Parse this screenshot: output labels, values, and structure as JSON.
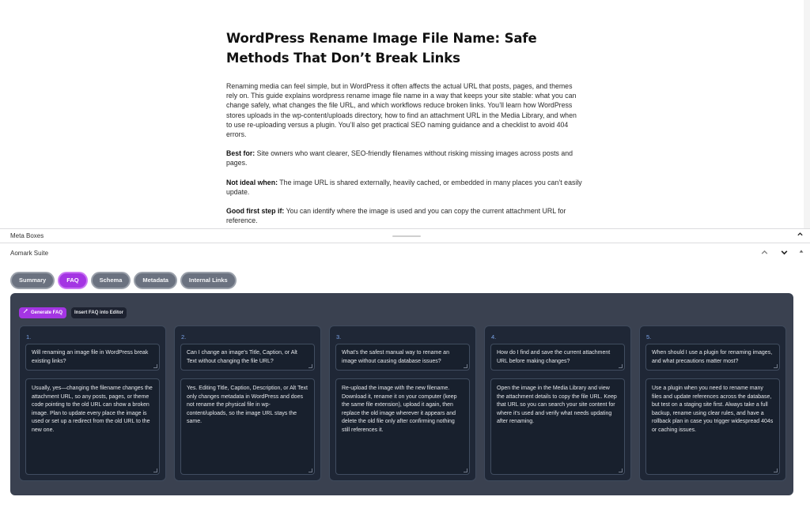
{
  "article": {
    "title": "WordPress Rename Image File Name: Safe Methods That Don’t Break Links",
    "intro": "Renaming media can feel simple, but in WordPress it often affects the actual URL that posts, pages, and themes rely on. This guide explains wordpress rename image file name in a way that keeps your site stable: what you can change safely, what changes the file URL, and which workflows reduce broken links. You’ll learn how WordPress stores uploads in the wp-content/uploads directory, how to find an attachment URL in the Media Library, and when to use re-uploading versus a plugin. You’ll also get practical SEO naming guidance and a checklist to avoid 404 errors.",
    "best_for_label": "Best for:",
    "best_for_text": " Site owners who want clearer, SEO-friendly filenames without risking missing images across posts and pages.",
    "not_ideal_label": "Not ideal when:",
    "not_ideal_text": " The image URL is shared externally, heavily cached, or embedded in many places you can’t easily update.",
    "first_step_label": "Good first step if:",
    "first_step_text": " You can identify where the image is used and you can copy the current attachment URL for reference."
  },
  "metabar": {
    "label": "Meta Boxes",
    "toggle_icon": "chevron-up-icon"
  },
  "suite": {
    "label": "Aomark Suite",
    "controls": {
      "up": "chevron-up-icon",
      "down": "chevron-down-icon",
      "collapse": "triangle-up-icon"
    },
    "tabs": [
      {
        "label": "Summary",
        "active": false
      },
      {
        "label": "FAQ",
        "active": true
      },
      {
        "label": "Schema",
        "active": false
      },
      {
        "label": "Metadata",
        "active": false
      },
      {
        "label": "Internal Links",
        "active": false
      }
    ],
    "generate_label": "Generate FAQ",
    "insert_label": "Insert FAQ into Editor",
    "accent": "#a435e3",
    "panel_bg": "#3a4150"
  },
  "faq": [
    {
      "num": "1.",
      "question": "Will renaming an image file in WordPress break existing links?",
      "answer": "Usually, yes—changing the filename changes the attachment URL, so any posts, pages, or theme code pointing to the old URL can show a broken image. Plan to update every place the image is used or set up a redirect from the old URL to the new one."
    },
    {
      "num": "2.",
      "question": "Can I change an image's Title, Caption, or Alt Text without changing the file URL?",
      "answer": "Yes. Editing Title, Caption, Description, or Alt Text only changes metadata in WordPress and does not rename the physical file in wp-content/uploads, so the image URL stays the same."
    },
    {
      "num": "3.",
      "question": "What's the safest manual way to rename an image without causing database issues?",
      "answer": "Re-upload the image with the new filename. Download it, rename it on your computer (keep the same file extension), upload it again, then replace the old image wherever it appears and delete the old file only after confirming nothing still references it."
    },
    {
      "num": "4.",
      "question": "How do I find and save the current attachment URL before making changes?",
      "answer": "Open the image in the Media Library and view the attachment details to copy the file URL. Keep that URL so you can search your site content for where it's used and verify what needs updating after renaming."
    },
    {
      "num": "5.",
      "question": "When should I use a plugin for renaming images, and what precautions matter most?",
      "answer": "Use a plugin when you need to rename many files and update references across the database, but test on a staging site first. Always take a full backup, rename using clear rules, and have a rollback plan in case you trigger widespread 404s or caching issues."
    }
  ]
}
